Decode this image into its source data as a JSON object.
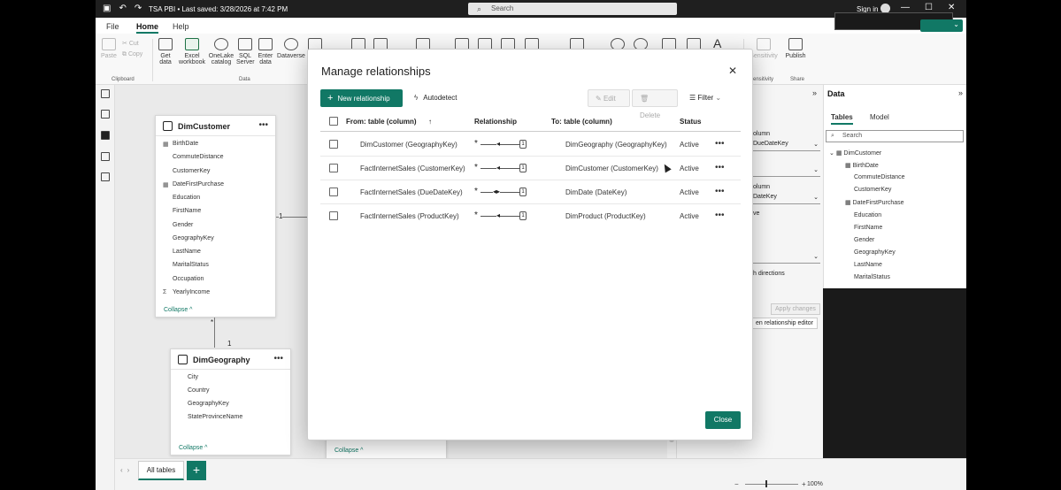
{
  "titlebar": {
    "title": "TSA PBI • Last saved: 3/28/2026 at 7:42 PM",
    "search_placeholder": "Search",
    "signin": "Sign in",
    "minimize": "—",
    "maximize": "☐",
    "close": "✕"
  },
  "menu": {
    "file": "File",
    "home": "Home",
    "help": "Help"
  },
  "ribbon": {
    "paste": "Paste",
    "cut": "Cut",
    "copy": "Copy",
    "get_data": "Get data",
    "excel": "Excel workbook",
    "onelake": "OneLake catalog",
    "sql": "SQL Server",
    "enter": "Enter data",
    "dataverse": "Dataverse",
    "sensitivity": "Sensitivity",
    "publish": "Publish",
    "group_clipboard": "Clipboard",
    "group_data": "Data",
    "group_sensitivity": "Sensitivity",
    "group_share": "Share"
  },
  "model": {
    "dimcustomer": {
      "title": "DimCustomer",
      "more": "•••",
      "fields": [
        "BirthDate",
        "CommuteDistance",
        "CustomerKey",
        "DateFirstPurchase",
        "Education",
        "FirstName",
        "Gender",
        "GeographyKey",
        "LastName",
        "MaritalStatus",
        "Occupation",
        "YearlyIncome"
      ],
      "collapse": "Collapse ^"
    },
    "dimgeography": {
      "title": "DimGeography",
      "more": "•••",
      "fields": [
        "City",
        "Country",
        "GeographyKey",
        "StateProvinceName"
      ],
      "collapse": "Collapse ^"
    },
    "third_collapse": "Collapse ^",
    "rel_one_a": "1",
    "rel_star": "*",
    "rel_one_b": "1"
  },
  "bottom": {
    "tab": "All tables",
    "add": "+",
    "zoom_minus": "−",
    "zoom_plus": "+",
    "zoom": "100%"
  },
  "properties": {
    "col1": "olumn",
    "drop1": "DueDateKey",
    "col2": "olumn",
    "drop2": "DateKey",
    "active": "ve",
    "directions": "h directions",
    "apply": "Apply changes",
    "open_editor": "en relationship editor"
  },
  "data_panel": {
    "title": "Data",
    "tab_tables": "Tables",
    "tab_model": "Model",
    "search_placeholder": "Search",
    "table": "DimCustomer",
    "fields": [
      "BirthDate",
      "CommuteDistance",
      "CustomerKey",
      "DateFirstPurchase",
      "Education",
      "FirstName",
      "Gender",
      "GeographyKey",
      "LastName",
      "MaritalStatus"
    ]
  },
  "dialog": {
    "title": "Manage relationships",
    "new_relationship": "New relationship",
    "autodetect": "Autodetect",
    "edit": "Edit",
    "delete": "Delete",
    "filter": "Filter",
    "col_from": "From: table (column)",
    "col_relationship": "Relationship",
    "col_to": "To: table (column)",
    "col_status": "Status",
    "rows": [
      {
        "from": "DimCustomer (GeographyKey)",
        "to": "DimGeography (GeographyKey)",
        "status": "Active",
        "one": "1",
        "many": "*",
        "more": "•••"
      },
      {
        "from": "FactInternetSales (CustomerKey)",
        "to": "DimCustomer (CustomerKey)",
        "status": "Active",
        "one": "1",
        "many": "*",
        "more": "•••"
      },
      {
        "from": "FactInternetSales (DueDateKey)",
        "to": "DimDate (DateKey)",
        "status": "Active",
        "one": "1",
        "many": "*",
        "more": "•••"
      },
      {
        "from": "FactInternetSales (ProductKey)",
        "to": "DimProduct (ProductKey)",
        "status": "Active",
        "one": "1",
        "many": "*",
        "more": "•••"
      }
    ],
    "close": "Close"
  }
}
